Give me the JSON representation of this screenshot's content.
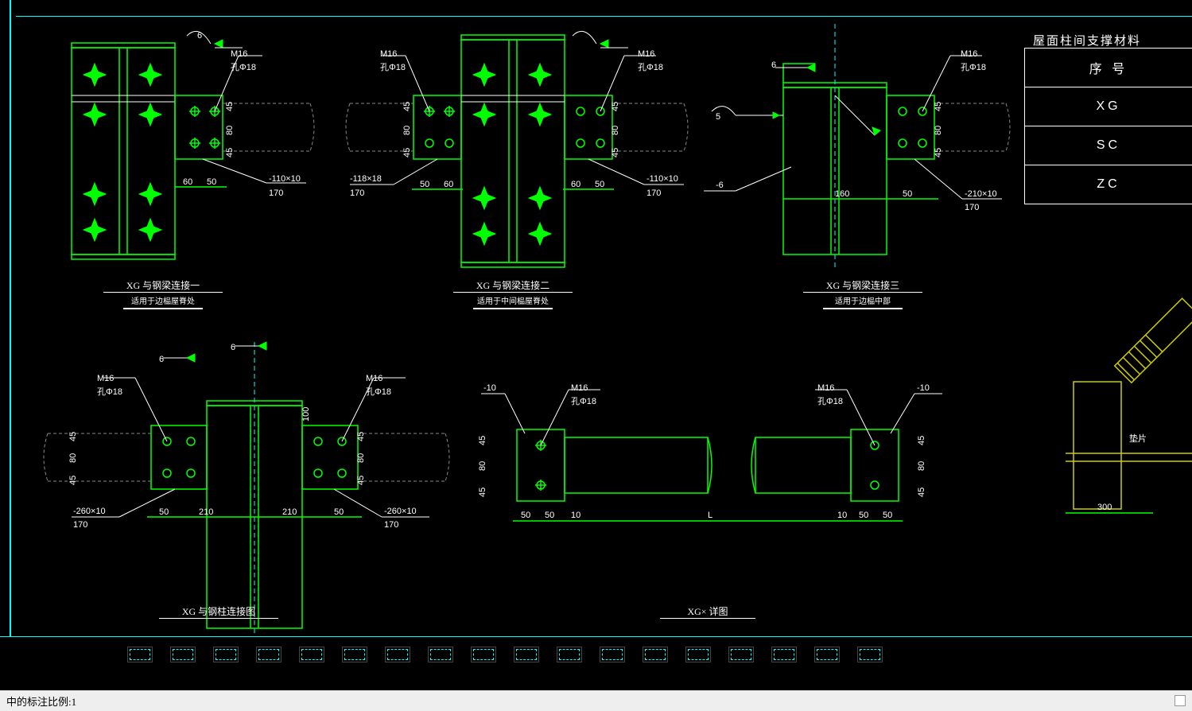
{
  "drawing": {
    "title1": {
      "name": "XG 与钢梁连接一",
      "note": "适用于边榀屋脊处"
    },
    "title2": {
      "name": "XG 与钢梁连接二",
      "note": "适用于中间榀屋脊处"
    },
    "title3": {
      "name": "XG 与钢梁连接三",
      "note": "适用于边榀中部"
    },
    "title4": {
      "name": "XG 与钢柱连接图"
    },
    "title5": {
      "name": "XG× 详图"
    }
  },
  "annotations": {
    "bolt": "M16",
    "hole": "孔Φ18",
    "plate_neg110": "-110×10",
    "plate_neg118": "-118×18",
    "plate_neg210": "-210×10",
    "plate_neg260": "-260×10",
    "neg6": "-6",
    "neg10": "-10",
    "weld5": "5",
    "weld6": "6",
    "pad": "垫片",
    "d170": "170",
    "d60": "60",
    "d50": "50",
    "d45": "45",
    "d80": "80",
    "d100": "100",
    "d160": "160",
    "d210": "210",
    "d300": "300",
    "d10": "10",
    "L": "L"
  },
  "table": {
    "title": "屋面柱间支撑材料",
    "rows": [
      "序 号",
      "XG",
      "SC",
      "ZC"
    ]
  },
  "statusbar": "中的标注比例:1"
}
